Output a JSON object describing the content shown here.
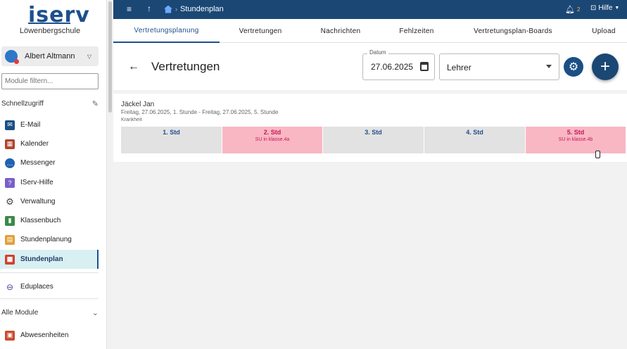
{
  "sidebar": {
    "logo": "iserv",
    "school": "Löwenbergschule",
    "user_name": "Albert Altmann",
    "filter_placeholder": "Module filtern...",
    "quick_access_label": "Schnellzugriff",
    "quick_items": [
      {
        "label": "E-Mail",
        "icon": "mail-icon"
      },
      {
        "label": "Kalender",
        "icon": "calendar-icon"
      },
      {
        "label": "Messenger",
        "icon": "chat-icon"
      },
      {
        "label": "IServ-Hilfe",
        "icon": "help-icon"
      },
      {
        "label": "Verwaltung",
        "icon": "gear-icon"
      },
      {
        "label": "Klassenbuch",
        "icon": "book-icon"
      },
      {
        "label": "Stundenplanung",
        "icon": "planning-icon"
      },
      {
        "label": "Stundenplan",
        "icon": "timetable-icon",
        "active": true
      }
    ],
    "eduplaces_label": "Eduplaces",
    "all_modules_label": "Alle Module",
    "abwesenheiten_label": "Abwesenheiten"
  },
  "topbar": {
    "menu_icon": "hamburger-icon",
    "up_icon": "arrow-up-icon",
    "breadcrumb": "Stundenplan",
    "notification_count": "2",
    "help_label": "Hilfe"
  },
  "tabs": [
    {
      "label": "Vertretungsplanung",
      "active": true
    },
    {
      "label": "Vertretungen"
    },
    {
      "label": "Nachrichten"
    },
    {
      "label": "Fehlzeiten"
    },
    {
      "label": "Vertretungsplan-Boards"
    },
    {
      "label": "Upload"
    }
  ],
  "main": {
    "title": "Vertretungen",
    "date_label": "Datum",
    "date_value": "27.06.2025",
    "select_value": "Lehrer",
    "entry": {
      "person": "Jäckel Jan",
      "period": "Freitag, 27.06.2025, 1. Stunde - Freitag, 27.06.2025, 5. Stunde",
      "reason": "Krankheit",
      "lessons": [
        {
          "header": "1. Std",
          "text": "",
          "substituted": false
        },
        {
          "header": "2. Std",
          "text": "SU in klasse.4a",
          "substituted": true
        },
        {
          "header": "3. Std",
          "text": "",
          "substituted": false
        },
        {
          "header": "4. Std",
          "text": "",
          "substituted": false
        },
        {
          "header": "5. Std",
          "text": "SU in klasse.4b",
          "substituted": true
        }
      ]
    }
  },
  "colors": {
    "brand": "#1b4775",
    "accent": "#1d4f8c",
    "substitution_bg": "#f9b7c3",
    "substitution_text": "#c2185b",
    "active_nav_bg": "#d9f0f2"
  }
}
